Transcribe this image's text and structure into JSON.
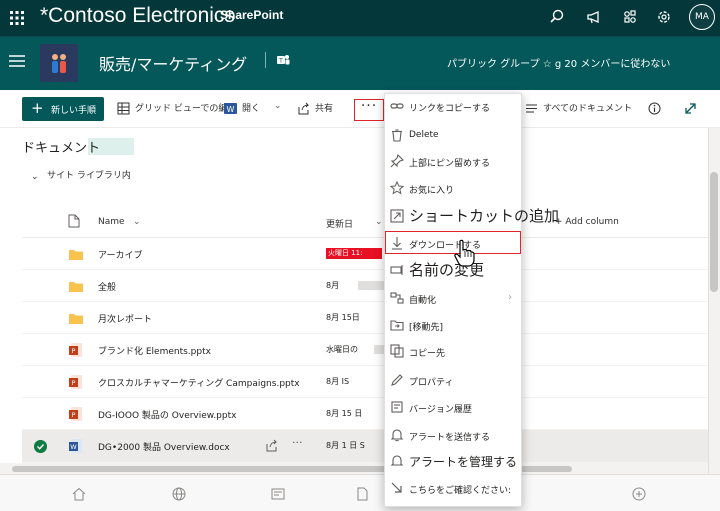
{
  "suite": {
    "app_title": "*Contoso Electronics",
    "app_sub": "SharePoint",
    "avatar_initials": "MA",
    "icons": [
      "waffle-icon",
      "search-icon",
      "megaphone-icon",
      "connections-icon",
      "settings-icon"
    ]
  },
  "site": {
    "title": "販売/マーケティング",
    "privacy": "パブリック グループ ☆ g 20 メンバーに従わない"
  },
  "commands": {
    "new": "新しい手順",
    "grid_edit": "グリッド ビューでの編集",
    "open": "開く",
    "share": "共有",
    "more": "···",
    "all_documents": "すべてのドキュメント"
  },
  "library": {
    "breadcrumb": "ドキュメント",
    "view_name": "サイト ライブラリ内"
  },
  "list": {
    "headers": {
      "name": "Name",
      "modified": "更新日",
      "add_column": "+ Add column"
    },
    "rows": [
      {
        "name": "アーカイブ",
        "date": "火曜日 11:",
        "type": "folder"
      },
      {
        "name": "全般",
        "date": "8月",
        "type": "folder"
      },
      {
        "name": "月次レポート",
        "date": "8月 15日",
        "type": "folder"
      },
      {
        "name": "ブランド化 Elements.pptx",
        "date": "水曜日の",
        "type": "pptx"
      },
      {
        "name": "クロスカルチャマーケティング Campaigns.pptx",
        "date": "8月 IS",
        "type": "pptx"
      },
      {
        "name": "DG-IOOO 製品の Overview.pptx",
        "date": "8月 15 日",
        "type": "pptx"
      },
      {
        "name": "DG•2000 製品 Overview.docx",
        "date": "8月 1 日 S",
        "type": "docx"
      }
    ]
  },
  "menu": {
    "items": [
      {
        "label": "リンクをコピーする",
        "icon": "link-icon"
      },
      {
        "label": "Delete",
        "icon": "trash-icon"
      },
      {
        "label": "上部にピン留めする",
        "icon": "pin-icon"
      },
      {
        "label": "お気に入り",
        "icon": "star-icon"
      },
      {
        "label": "ショートカットの追加",
        "icon": "shortcut-icon"
      },
      {
        "label": "ダウンロードする",
        "icon": "download-icon"
      },
      {
        "label": "名前の変更",
        "icon": "rename-icon"
      },
      {
        "label": "自動化",
        "icon": "automate-icon"
      },
      {
        "label": "[移動先]",
        "icon": "move-icon"
      },
      {
        "label": "コピー先",
        "icon": "copy-icon"
      },
      {
        "label": "プロパティ",
        "icon": "pencil-icon"
      },
      {
        "label": "バージョン履歴",
        "icon": "history-icon"
      },
      {
        "label": "アラートを送信する",
        "icon": "bell-icon"
      },
      {
        "label": "アラートを管理する",
        "icon": "manage-alert-icon"
      },
      {
        "label": "こちらをご確認ください:",
        "icon": "arrow-icon"
      }
    ]
  },
  "colors": {
    "suite_bar": "#03373a",
    "site_header": "#04585a",
    "accent": "#04585a",
    "highlight_red": "#e0242a",
    "check_green": "#107c41"
  }
}
